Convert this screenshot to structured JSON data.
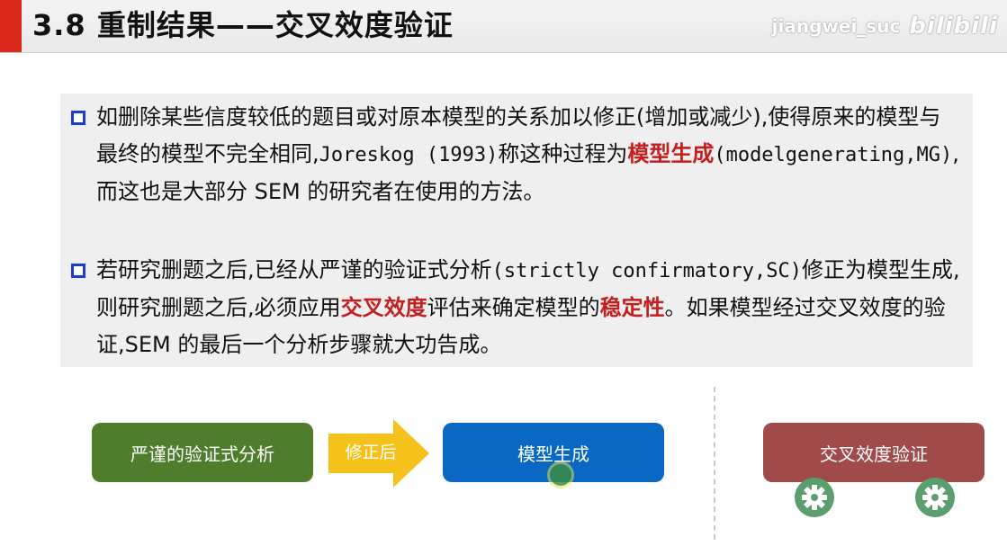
{
  "header": {
    "title": "3.8 重制结果——交叉效度验证",
    "watermark_user": "jiangwei_suc",
    "watermark_brand": "bilibili",
    "accent_color": "#d9281c"
  },
  "content": {
    "para1": {
      "text_a": "如删除某些信度较低的题目或对原本模型的关系加以修正(增加或减少),使得原来的模型与最终的模型不完全相同,",
      "text_b": "Joreskog (1993)",
      "text_c": "称这种过程为",
      "highlight": "模型生成",
      "text_d": "(modelgenerating,MG)",
      "text_e": ",而这也是大部分 SEM 的研究者在使用的方法。"
    },
    "para2": {
      "text_a": "若研究删题之后,已经从严谨的验证式分析",
      "text_b": "(strictly confirmatory,SC)",
      "text_c": "修正为模型生成,则研究删题之后,必须应用",
      "highlight1": "交叉效度",
      "text_d": "评估来确定模型的",
      "highlight2": "稳定性",
      "text_e": "。如果模型经过交叉效度的验证,SEM 的最后一个分析步骤就大功告成。"
    },
    "bullet_color": "#1b3bd6",
    "highlight_color": "#c41e1e"
  },
  "flow": {
    "step1": "严谨的验证式分析",
    "arrow_label": "修正后",
    "step2": "模型生成",
    "step3": "交叉效度验证",
    "colors": {
      "step1": "#4e7d2c",
      "arrow": "#f5c21b",
      "step2": "#0a68c4",
      "step3": "#a04a4a",
      "gear": "#5c9f6e"
    },
    "icons": [
      "gear-icon",
      "gear-icon"
    ]
  }
}
